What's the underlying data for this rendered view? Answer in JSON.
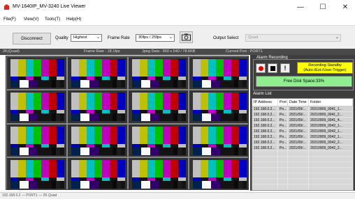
{
  "window": {
    "title": "MV-1640IP_MV-3240 Live Viewer",
    "minimize_glyph": "—",
    "maximize_glyph": "☐",
    "close_glyph": "✕"
  },
  "menu": [
    "File(F)",
    "View(V)",
    "Tools(T)",
    "Help(H)"
  ],
  "toolbar": {
    "disconnect_label": "Disconnect",
    "quality_label": "Quality",
    "quality_value": "Highest",
    "frame_rate_label": "Frame Rate",
    "frame_rate_value": "30fps / 25fps",
    "output_select_label": "Output Select",
    "output_select_value": "Quad"
  },
  "info": {
    "mode": "2K(Quad)",
    "frame_rate": "Frame Rate : 18.1fps",
    "jpeg_data": "Jpeg Data : 960 x 540 / 78.6KB",
    "current_port": "Current Port : PORT1"
  },
  "alarm_recording": {
    "title": "Alarm Recording",
    "standby_line1": "Recording Standby",
    "standby_line2": "(Auto-/Ext-/User-Trigger)",
    "free_disk": "Free Disk Space:33%"
  },
  "alarm_list": {
    "title": "Alarm List",
    "columns": [
      "IP Address",
      "Port",
      "Date Time",
      "Folder"
    ],
    "rows": [
      [
        "192.168.0.2...",
        "Po...",
        "2021/09/...",
        "20210909_0041_1..."
      ],
      [
        "192.168.0.2...",
        "Po...",
        "2021/09/...",
        "20210909_0041_2..."
      ],
      [
        "192.168.0.2...",
        "Po...",
        "2021/09/...",
        "20210909_0041_4..."
      ],
      [
        "192.168.0.2...",
        "Po...",
        "2021/09/...",
        "20210909_0042_1..."
      ],
      [
        "192.168.0.2...",
        "Po...",
        "2021/09/...",
        "20210909_0042_1..."
      ],
      [
        "192.168.0.2...",
        "Po...",
        "2021/09/...",
        "20210909_0042_1..."
      ],
      [
        "192.168.0.2...",
        "Po...",
        "2021/09/...",
        "20210909_0042_2..."
      ],
      [
        "192.168.0.2...",
        "Po...",
        "2021/09/...",
        "20210909_0042_2..."
      ]
    ]
  },
  "status_bar": {
    "text": "192.168.0.2 — PORT1 — 2K Quad"
  },
  "colors": {
    "titlebar": "#ffffff",
    "toolbar": "#efefef",
    "infobar": "#4a4a4a",
    "side_panel": "#3e3e3e",
    "standby": "#ffff00",
    "disk": "#90ee90",
    "rec_dot": "#ee0000"
  }
}
